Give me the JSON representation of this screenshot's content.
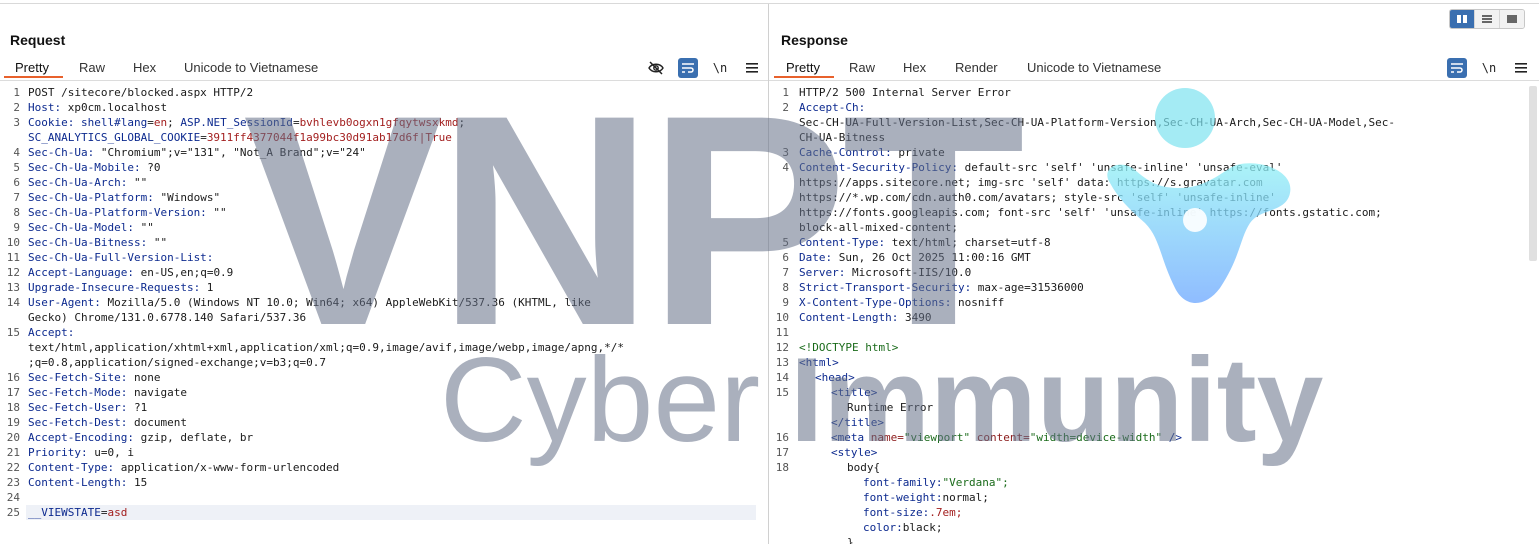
{
  "layout_toggle": [
    "side-by-side",
    "top-bottom",
    "tabs"
  ],
  "colors": {
    "accent": "#e8612c",
    "header_key": "#0d2a8f",
    "cookie_value": "#a32020",
    "watermark": "#646f87",
    "logo_cyan": "#7ee3f0",
    "logo_blue": "#6aa6ff"
  },
  "watermark": {
    "vnpt": "VNPT",
    "cyber": "Cyber",
    "immunity": "Immunity"
  },
  "request": {
    "title": "Request",
    "tabs": [
      {
        "label": "Pretty",
        "active": true
      },
      {
        "label": "Raw"
      },
      {
        "label": "Hex"
      },
      {
        "label": "Unicode to Vietnamese"
      }
    ],
    "tools": {
      "hide_icon": "eye-off-icon",
      "wrap_icon": "wrap-lines-icon",
      "newline_label": "\\n",
      "menu_icon": "hamburger-menu-icon"
    },
    "lines": [
      {
        "n": "1",
        "parts": [
          {
            "t": "POST /sitecore/blocked.aspx HTTP/2",
            "c": "v"
          }
        ]
      },
      {
        "n": "2",
        "parts": [
          {
            "t": "Host:",
            "c": "k"
          },
          {
            "t": " xp0cm.localhost",
            "c": "v"
          }
        ]
      },
      {
        "n": "3",
        "parts": [
          {
            "t": "Cookie:",
            "c": "k"
          },
          {
            "t": " ",
            "c": "v"
          },
          {
            "t": "shell#lang",
            "c": "k"
          },
          {
            "t": "=",
            "c": "v"
          },
          {
            "t": "en",
            "c": "c"
          },
          {
            "t": "; ",
            "c": "v"
          },
          {
            "t": "ASP.NET_SessionId",
            "c": "k"
          },
          {
            "t": "=",
            "c": "v"
          },
          {
            "t": "bvhlevb0ogxn1gfqytwsxkmd",
            "c": "c"
          },
          {
            "t": ";",
            "c": "v"
          }
        ]
      },
      {
        "n": "",
        "parts": [
          {
            "t": "SC_ANALYTICS_GLOBAL_COOKIE",
            "c": "k"
          },
          {
            "t": "=",
            "c": "v"
          },
          {
            "t": "3911ff4377044f1a99bc30d91ab17d6f|True",
            "c": "c"
          }
        ]
      },
      {
        "n": "4",
        "parts": [
          {
            "t": "Sec-Ch-Ua:",
            "c": "k"
          },
          {
            "t": " \"Chromium\";v=\"131\", \"Not_A Brand\";v=\"24\"",
            "c": "v"
          }
        ]
      },
      {
        "n": "5",
        "parts": [
          {
            "t": "Sec-Ch-Ua-Mobile:",
            "c": "k"
          },
          {
            "t": " ?0",
            "c": "v"
          }
        ]
      },
      {
        "n": "6",
        "parts": [
          {
            "t": "Sec-Ch-Ua-Arch:",
            "c": "k"
          },
          {
            "t": " \"\"",
            "c": "v"
          }
        ]
      },
      {
        "n": "7",
        "parts": [
          {
            "t": "Sec-Ch-Ua-Platform:",
            "c": "k"
          },
          {
            "t": " \"Windows\"",
            "c": "v"
          }
        ]
      },
      {
        "n": "8",
        "parts": [
          {
            "t": "Sec-Ch-Ua-Platform-Version:",
            "c": "k"
          },
          {
            "t": " \"\"",
            "c": "v"
          }
        ]
      },
      {
        "n": "9",
        "parts": [
          {
            "t": "Sec-Ch-Ua-Model:",
            "c": "k"
          },
          {
            "t": " \"\"",
            "c": "v"
          }
        ]
      },
      {
        "n": "10",
        "parts": [
          {
            "t": "Sec-Ch-Ua-Bitness:",
            "c": "k"
          },
          {
            "t": " \"\"",
            "c": "v"
          }
        ]
      },
      {
        "n": "11",
        "parts": [
          {
            "t": "Sec-Ch-Ua-Full-Version-List:",
            "c": "k"
          }
        ]
      },
      {
        "n": "12",
        "parts": [
          {
            "t": "Accept-Language:",
            "c": "k"
          },
          {
            "t": " en-US,en;q=0.9",
            "c": "v"
          }
        ]
      },
      {
        "n": "13",
        "parts": [
          {
            "t": "Upgrade-Insecure-Requests:",
            "c": "k"
          },
          {
            "t": " 1",
            "c": "v"
          }
        ]
      },
      {
        "n": "14",
        "parts": [
          {
            "t": "User-Agent:",
            "c": "k"
          },
          {
            "t": " Mozilla/5.0 (Windows NT 10.0; Win64; x64) AppleWebKit/537.36 (KHTML, like",
            "c": "v"
          }
        ]
      },
      {
        "n": "",
        "parts": [
          {
            "t": "Gecko) Chrome/131.0.6778.140 Safari/537.36",
            "c": "v"
          }
        ]
      },
      {
        "n": "15",
        "parts": [
          {
            "t": "Accept:",
            "c": "k"
          }
        ]
      },
      {
        "n": "",
        "parts": [
          {
            "t": "text/html,application/xhtml+xml,application/xml;q=0.9,image/avif,image/webp,image/apng,*/*",
            "c": "v"
          }
        ]
      },
      {
        "n": "",
        "parts": [
          {
            "t": ";q=0.8,application/signed-exchange;v=b3;q=0.7",
            "c": "v"
          }
        ]
      },
      {
        "n": "16",
        "parts": [
          {
            "t": "Sec-Fetch-Site:",
            "c": "k"
          },
          {
            "t": " none",
            "c": "v"
          }
        ]
      },
      {
        "n": "17",
        "parts": [
          {
            "t": "Sec-Fetch-Mode:",
            "c": "k"
          },
          {
            "t": " navigate",
            "c": "v"
          }
        ]
      },
      {
        "n": "18",
        "parts": [
          {
            "t": "Sec-Fetch-User:",
            "c": "k"
          },
          {
            "t": " ?1",
            "c": "v"
          }
        ]
      },
      {
        "n": "19",
        "parts": [
          {
            "t": "Sec-Fetch-Dest:",
            "c": "k"
          },
          {
            "t": " document",
            "c": "v"
          }
        ]
      },
      {
        "n": "20",
        "parts": [
          {
            "t": "Accept-Encoding:",
            "c": "k"
          },
          {
            "t": " gzip, deflate, br",
            "c": "v"
          }
        ]
      },
      {
        "n": "21",
        "parts": [
          {
            "t": "Priority:",
            "c": "k"
          },
          {
            "t": " u=0, i",
            "c": "v"
          }
        ]
      },
      {
        "n": "22",
        "parts": [
          {
            "t": "Content-Type:",
            "c": "k"
          },
          {
            "t": " application/x-www-form-urlencoded",
            "c": "v"
          }
        ]
      },
      {
        "n": "23",
        "parts": [
          {
            "t": "Content-Length:",
            "c": "k"
          },
          {
            "t": " 15",
            "c": "v"
          }
        ]
      },
      {
        "n": "24",
        "parts": []
      },
      {
        "n": "25",
        "hl": true,
        "parts": [
          {
            "t": "__VIEWSTATE",
            "c": "k"
          },
          {
            "t": "=",
            "c": "v"
          },
          {
            "t": "asd",
            "c": "c"
          }
        ]
      }
    ]
  },
  "response": {
    "title": "Response",
    "tabs": [
      {
        "label": "Pretty",
        "active": true
      },
      {
        "label": "Raw"
      },
      {
        "label": "Hex"
      },
      {
        "label": "Render"
      },
      {
        "label": "Unicode to Vietnamese"
      }
    ],
    "tools": {
      "wrap_icon": "wrap-lines-icon",
      "newline_label": "\\n",
      "menu_icon": "hamburger-menu-icon"
    },
    "lines": [
      {
        "n": "1",
        "parts": [
          {
            "t": "HTTP/2 500 Internal Server Error",
            "c": "v"
          }
        ]
      },
      {
        "n": "2",
        "parts": [
          {
            "t": "Accept-Ch:",
            "c": "k"
          }
        ]
      },
      {
        "n": "",
        "parts": [
          {
            "t": "Sec-CH-UA-Full-Version-List,Sec-CH-UA-Platform-Version,Sec-CH-UA-Arch,Sec-CH-UA-Model,Sec-",
            "c": "v"
          }
        ]
      },
      {
        "n": "",
        "parts": [
          {
            "t": "CH-UA-Bitness",
            "c": "v"
          }
        ]
      },
      {
        "n": "3",
        "parts": [
          {
            "t": "Cache-Control:",
            "c": "k"
          },
          {
            "t": " private",
            "c": "v"
          }
        ]
      },
      {
        "n": "4",
        "parts": [
          {
            "t": "Content-Security-Policy:",
            "c": "k"
          },
          {
            "t": " default-src 'self' 'unsafe-inline' 'unsafe-eval'",
            "c": "v"
          }
        ]
      },
      {
        "n": "",
        "parts": [
          {
            "t": "https://apps.sitecore.net; img-src 'self' data: https://s.gravatar.com",
            "c": "v"
          }
        ]
      },
      {
        "n": "",
        "parts": [
          {
            "t": "https://*.wp.com/cdn.auth0.com/avatars; style-src 'self' 'unsafe-inline'",
            "c": "v"
          }
        ]
      },
      {
        "n": "",
        "parts": [
          {
            "t": "https://fonts.googleapis.com; font-src 'self' 'unsafe-inline' https://fonts.gstatic.com;",
            "c": "v"
          }
        ]
      },
      {
        "n": "",
        "parts": [
          {
            "t": "block-all-mixed-content;",
            "c": "v"
          }
        ]
      },
      {
        "n": "5",
        "parts": [
          {
            "t": "Content-Type:",
            "c": "k"
          },
          {
            "t": " text/html; charset=utf-8",
            "c": "v"
          }
        ]
      },
      {
        "n": "6",
        "parts": [
          {
            "t": "Date:",
            "c": "k"
          },
          {
            "t": " Sun, 26 Oct 2025 11:00:16 GMT",
            "c": "v"
          }
        ]
      },
      {
        "n": "7",
        "parts": [
          {
            "t": "Server:",
            "c": "k"
          },
          {
            "t": " Microsoft-IIS/10.0",
            "c": "v"
          }
        ]
      },
      {
        "n": "8",
        "parts": [
          {
            "t": "Strict-Transport-Security:",
            "c": "k"
          },
          {
            "t": " max-age=31536000",
            "c": "v"
          }
        ]
      },
      {
        "n": "9",
        "parts": [
          {
            "t": "X-Content-Type-Options:",
            "c": "k"
          },
          {
            "t": " nosniff",
            "c": "v"
          }
        ]
      },
      {
        "n": "10",
        "parts": [
          {
            "t": "Content-Length:",
            "c": "k"
          },
          {
            "t": " 3490",
            "c": "v"
          }
        ]
      },
      {
        "n": "11",
        "parts": []
      },
      {
        "n": "12",
        "parts": [
          {
            "t": "<!DOCTYPE html>",
            "c": "str"
          }
        ]
      },
      {
        "n": "13",
        "parts": [
          {
            "t": "<html>",
            "c": "tag"
          }
        ]
      },
      {
        "n": "14",
        "ind": "ind1",
        "parts": [
          {
            "t": "<head>",
            "c": "tag"
          }
        ]
      },
      {
        "n": "15",
        "ind": "ind2",
        "parts": [
          {
            "t": "<title>",
            "c": "tag"
          }
        ]
      },
      {
        "n": "",
        "ind": "ind3",
        "parts": [
          {
            "t": "Runtime Error",
            "c": "v"
          }
        ]
      },
      {
        "n": "",
        "ind": "ind2",
        "parts": [
          {
            "t": "</title>",
            "c": "tag"
          }
        ]
      },
      {
        "n": "16",
        "ind": "ind2",
        "parts": [
          {
            "t": "<meta ",
            "c": "tag"
          },
          {
            "t": "name=",
            "c": "attr"
          },
          {
            "t": "\"viewport\" ",
            "c": "str"
          },
          {
            "t": "content=",
            "c": "attr"
          },
          {
            "t": "\"width=device-width\" ",
            "c": "str"
          },
          {
            "t": "/>",
            "c": "tag"
          }
        ]
      },
      {
        "n": "17",
        "ind": "ind2",
        "parts": [
          {
            "t": "<style>",
            "c": "tag"
          }
        ]
      },
      {
        "n": "18",
        "ind": "ind3",
        "parts": [
          {
            "t": "body{",
            "c": "v"
          }
        ]
      },
      {
        "n": "",
        "ind": "ind4",
        "parts": [
          {
            "t": "font-family:",
            "c": "k"
          },
          {
            "t": "\"Verdana\";",
            "c": "str"
          }
        ]
      },
      {
        "n": "",
        "ind": "ind4",
        "parts": [
          {
            "t": "font-weight:",
            "c": "k"
          },
          {
            "t": "normal;",
            "c": "v"
          }
        ]
      },
      {
        "n": "",
        "ind": "ind4",
        "parts": [
          {
            "t": "font-size:",
            "c": "k"
          },
          {
            "t": ".7em;",
            "c": "c"
          }
        ]
      },
      {
        "n": "",
        "ind": "ind4",
        "parts": [
          {
            "t": "color:",
            "c": "k"
          },
          {
            "t": "black;",
            "c": "v"
          }
        ]
      },
      {
        "n": "",
        "ind": "ind3",
        "parts": [
          {
            "t": "}",
            "c": "v"
          }
        ]
      }
    ]
  }
}
